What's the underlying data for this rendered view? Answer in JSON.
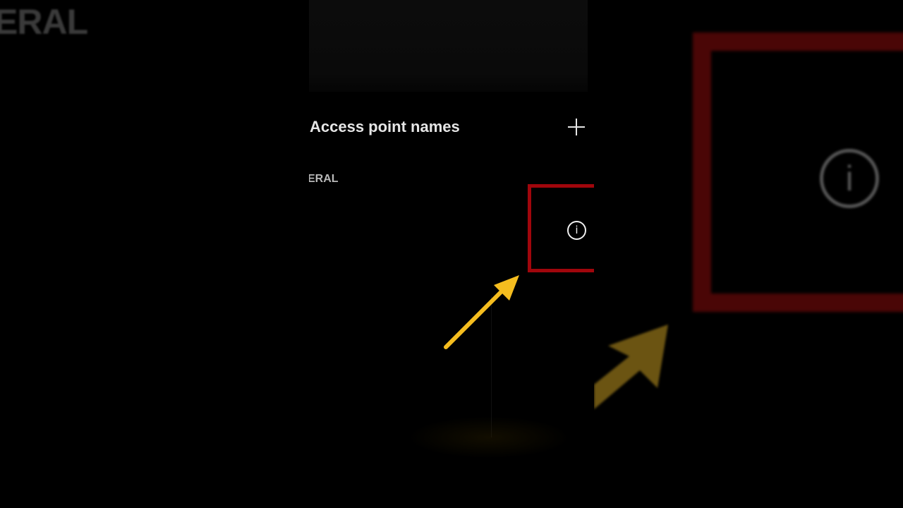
{
  "background_left": {
    "text": "ERAL"
  },
  "header": {
    "title": "Access point names",
    "add_icon": "plus-icon"
  },
  "section": {
    "label": "ERAL"
  },
  "info_icon": {
    "glyph": "i",
    "name": "info-icon"
  },
  "annotation": {
    "highlight_color": "#a0060c",
    "arrow_color": "#f5bd1f"
  },
  "background_right": {
    "info_glyph": "i"
  }
}
